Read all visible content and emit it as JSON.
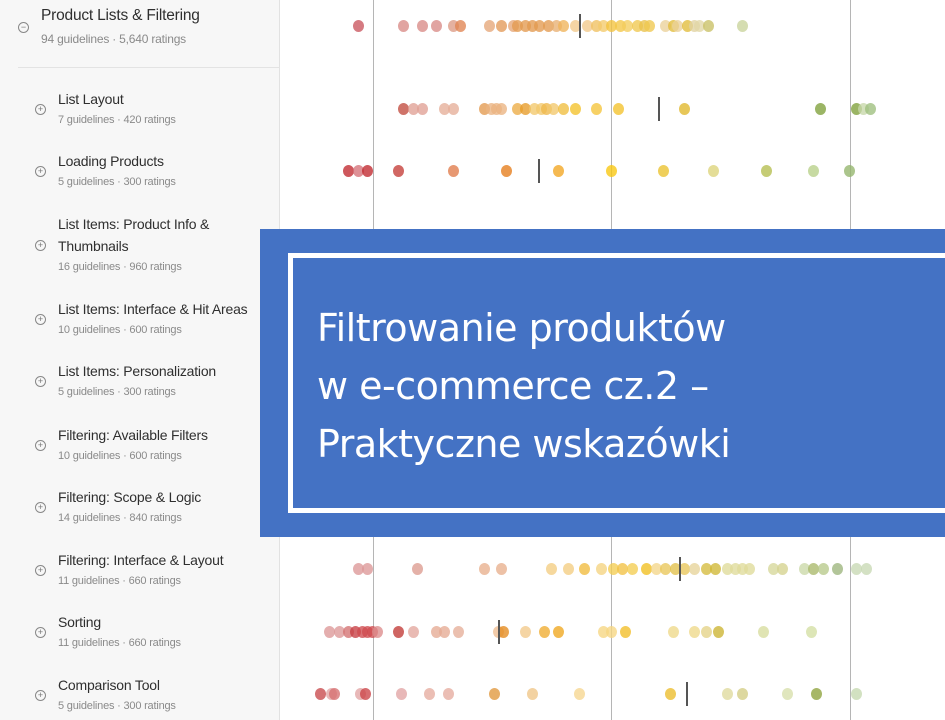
{
  "sidebar": {
    "parent": {
      "title": "Product Lists & Filtering",
      "meta": "94 guidelines · 5,640 ratings",
      "toggle": "minus-circle-icon"
    },
    "items": [
      {
        "title": "List Layout",
        "meta": "7 guidelines · 420 ratings"
      },
      {
        "title": "Loading Products",
        "meta": "5 guidelines · 300 ratings"
      },
      {
        "title": "List Items: Product Info & Thumbnails",
        "title_line1": "List Items: Product Info &",
        "title_line2": "Thumbnails",
        "meta": "16 guidelines · 960 ratings"
      },
      {
        "title": "List Items: Interface & Hit Areas",
        "meta": "10 guidelines · 600 ratings"
      },
      {
        "title": "List Items: Personalization",
        "meta": "5 guidelines · 300 ratings"
      },
      {
        "title": "Filtering: Available Filters",
        "meta": "10 guidelines · 600 ratings"
      },
      {
        "title": "Filtering: Scope & Logic",
        "meta": "14 guidelines · 840 ratings"
      },
      {
        "title": "Filtering: Interface & Layout",
        "meta": "11 guidelines · 660 ratings"
      },
      {
        "title": "Sorting",
        "meta": "11 guidelines · 660 ratings"
      },
      {
        "title": "Comparison Tool",
        "meta": "5 guidelines · 300 ratings"
      }
    ]
  },
  "overlay": {
    "lines": [
      "Filtrowanie produktów",
      "w e-commerce cz.2 –",
      "Praktyczne wskazówki"
    ],
    "background": "#4472c4",
    "text_color": "#ffffff"
  },
  "chart_data": {
    "type": "scatter",
    "title": "",
    "xlabel": "",
    "ylabel": "",
    "x_gridlines": [
      -1,
      0,
      1
    ],
    "xlim": [
      -1.39,
      1.4
    ],
    "rows": [
      {
        "name": "Product Lists & Filtering",
        "median": -0.13,
        "points": [
          [
            -1.06,
            "#c9545e"
          ],
          [
            -0.87,
            "#d98b86"
          ],
          [
            -0.79,
            "#d98b86"
          ],
          [
            -0.73,
            "#d98b86"
          ],
          [
            -0.66,
            "#dd9b85"
          ],
          [
            -0.63,
            "#e08452"
          ],
          [
            -0.51,
            "#e6a678"
          ],
          [
            -0.46,
            "#e39a58"
          ],
          [
            -0.41,
            "#e6a678"
          ],
          [
            -0.39,
            "#e39a4f"
          ],
          [
            -0.36,
            "#e39a4f"
          ],
          [
            -0.33,
            "#e39a4f"
          ],
          [
            -0.3,
            "#e39a4f"
          ],
          [
            -0.26,
            "#e39a4f"
          ],
          [
            -0.23,
            "#e8b072"
          ],
          [
            -0.2,
            "#efb45a"
          ],
          [
            -0.15,
            "#f2c98a"
          ],
          [
            -0.1,
            "#f2c98a"
          ],
          [
            -0.06,
            "#f0c060"
          ],
          [
            -0.03,
            "#f3cb6c"
          ],
          [
            0.0,
            "#f3c33e"
          ],
          [
            0.04,
            "#f4c746"
          ],
          [
            0.07,
            "#f4cd5e"
          ],
          [
            0.11,
            "#f0c84f"
          ],
          [
            0.14,
            "#e9c24b"
          ],
          [
            0.16,
            "#f0c84f"
          ],
          [
            0.23,
            "#ead19a"
          ],
          [
            0.26,
            "#e2bd3b"
          ],
          [
            0.28,
            "#ead19a"
          ],
          [
            0.32,
            "#e2bd3b"
          ],
          [
            0.35,
            "#e0d2a2"
          ],
          [
            0.37,
            "#e1d7a6"
          ],
          [
            0.41,
            "#c9c065"
          ],
          [
            0.55,
            "#c9d39b"
          ]
        ]
      },
      {
        "name": "List Layout",
        "median": 0.2,
        "points": [
          [
            -0.87,
            "#c24c3f"
          ],
          [
            -0.83,
            "#e0a095"
          ],
          [
            -0.79,
            "#e0a095"
          ],
          [
            -0.7,
            "#e6ae98"
          ],
          [
            -0.66,
            "#e6ae98"
          ],
          [
            -0.53,
            "#e39a50"
          ],
          [
            -0.5,
            "#eab381"
          ],
          [
            -0.48,
            "#eab381"
          ],
          [
            -0.46,
            "#eab381"
          ],
          [
            -0.39,
            "#ecac45"
          ],
          [
            -0.36,
            "#e79b28"
          ],
          [
            -0.32,
            "#f2c86c"
          ],
          [
            -0.29,
            "#f2c86c"
          ],
          [
            -0.27,
            "#eeb74a"
          ],
          [
            -0.24,
            "#f2c86c"
          ],
          [
            -0.2,
            "#f0be3f"
          ],
          [
            -0.15,
            "#f4c12a"
          ],
          [
            -0.06,
            "#f5c43a"
          ],
          [
            0.03,
            "#f4c12a"
          ],
          [
            0.31,
            "#e0b72a"
          ],
          [
            0.88,
            "#7fa03a"
          ],
          [
            1.03,
            "#7fa03a"
          ],
          [
            1.06,
            "#c6d7a9"
          ],
          [
            1.09,
            "#9ebf7e"
          ]
        ]
      },
      {
        "name": "Loading Products",
        "median": -0.3,
        "points": [
          [
            -1.1,
            "#c0282e"
          ],
          [
            -1.06,
            "#d57178"
          ],
          [
            -1.02,
            "#c0282e"
          ],
          [
            -0.89,
            "#c43c37"
          ],
          [
            -0.66,
            "#e07b4a"
          ],
          [
            -0.44,
            "#e67c1a"
          ],
          [
            -0.22,
            "#f2a520"
          ],
          [
            0.0,
            "#f9c70e"
          ],
          [
            0.22,
            "#ebc22d"
          ],
          [
            0.43,
            "#dcd47a"
          ],
          [
            0.65,
            "#b5be4e"
          ],
          [
            0.85,
            "#b7cf88"
          ],
          [
            1.0,
            "#93b56b"
          ]
        ]
      },
      {
        "name": "Filtering: Interface & Layout",
        "median": 0.29,
        "points": [
          [
            -1.06,
            "#dd9797"
          ],
          [
            -1.02,
            "#dd9797"
          ],
          [
            -0.81,
            "#dd9b8f"
          ],
          [
            -0.53,
            "#e8b08d"
          ],
          [
            -0.46,
            "#e8b08d"
          ],
          [
            -0.25,
            "#f3cd82"
          ],
          [
            -0.18,
            "#f3cd82"
          ],
          [
            -0.11,
            "#f1bb3e"
          ],
          [
            -0.04,
            "#f5d380"
          ],
          [
            0.01,
            "#f3cd52"
          ],
          [
            0.05,
            "#f2c244"
          ],
          [
            0.09,
            "#f3cd52"
          ],
          [
            0.15,
            "#f1bf1f"
          ],
          [
            0.19,
            "#f3d68a"
          ],
          [
            0.23,
            "#e9c65a"
          ],
          [
            0.27,
            "#e2c04a"
          ],
          [
            0.31,
            "#e9c65a"
          ],
          [
            0.35,
            "#e7d39a"
          ],
          [
            0.4,
            "#d5bb3d"
          ],
          [
            0.44,
            "#cfb734"
          ],
          [
            0.49,
            "#dfdb9a"
          ],
          [
            0.52,
            "#dfdb9a"
          ],
          [
            0.55,
            "#dfdb9a"
          ],
          [
            0.58,
            "#dfdb9a"
          ],
          [
            0.68,
            "#d6d79a"
          ],
          [
            0.72,
            "#d5d28e"
          ],
          [
            0.81,
            "#cad9a8"
          ],
          [
            0.85,
            "#a9b96a"
          ],
          [
            0.89,
            "#b7c98a"
          ],
          [
            0.95,
            "#9cb57c"
          ],
          [
            1.03,
            "#c8d8b4"
          ],
          [
            1.07,
            "#c8d8b4"
          ]
        ]
      },
      {
        "name": "Sorting",
        "median": -0.47,
        "points": [
          [
            -1.18,
            "#dd9797"
          ],
          [
            -1.14,
            "#dd9797"
          ],
          [
            -1.1,
            "#d47171"
          ],
          [
            -1.07,
            "#c63e42"
          ],
          [
            -1.04,
            "#d04c50"
          ],
          [
            -1.02,
            "#d04c50"
          ],
          [
            -1.0,
            "#d04c50"
          ],
          [
            -0.98,
            "#dd8c8c"
          ],
          [
            -0.89,
            "#c23a36"
          ],
          [
            -0.83,
            "#e3a69d"
          ],
          [
            -0.73,
            "#e5ab94"
          ],
          [
            -0.7,
            "#e5ab94"
          ],
          [
            -0.64,
            "#e6ae98"
          ],
          [
            -0.47,
            "#eebd91"
          ],
          [
            -0.45,
            "#e48a1e"
          ],
          [
            -0.36,
            "#f2c98a"
          ],
          [
            -0.28,
            "#efac30"
          ],
          [
            -0.22,
            "#f0a71d"
          ],
          [
            -0.03,
            "#f6d682"
          ],
          [
            0.0,
            "#f6d682"
          ],
          [
            0.06,
            "#f2be27"
          ],
          [
            0.26,
            "#eed989"
          ],
          [
            0.35,
            "#eed989"
          ],
          [
            0.4,
            "#e4d286"
          ],
          [
            0.45,
            "#ccb331"
          ],
          [
            0.64,
            "#d7dd9e"
          ],
          [
            0.84,
            "#d3dfa3"
          ]
        ]
      },
      {
        "name": "Comparison Tool",
        "median": 0.32,
        "points": [
          [
            -1.22,
            "#c8494c"
          ],
          [
            -1.17,
            "#e2a4a4"
          ],
          [
            -1.16,
            "#d66f71"
          ],
          [
            -1.05,
            "#e2a4a4"
          ],
          [
            -1.03,
            "#cc4448"
          ],
          [
            -0.88,
            "#e2a4a4"
          ],
          [
            -0.76,
            "#e5ac9f"
          ],
          [
            -0.68,
            "#e5ac9f"
          ],
          [
            -0.49,
            "#e0973c"
          ],
          [
            -0.33,
            "#f0c587"
          ],
          [
            -0.13,
            "#f6d690"
          ],
          [
            0.25,
            "#ecbd2a"
          ],
          [
            0.49,
            "#dfda9c"
          ],
          [
            0.55,
            "#d4cd84"
          ],
          [
            0.74,
            "#d7dfab"
          ],
          [
            0.86,
            "#8ea33c"
          ],
          [
            1.03,
            "#c5d9b0"
          ]
        ]
      }
    ]
  }
}
